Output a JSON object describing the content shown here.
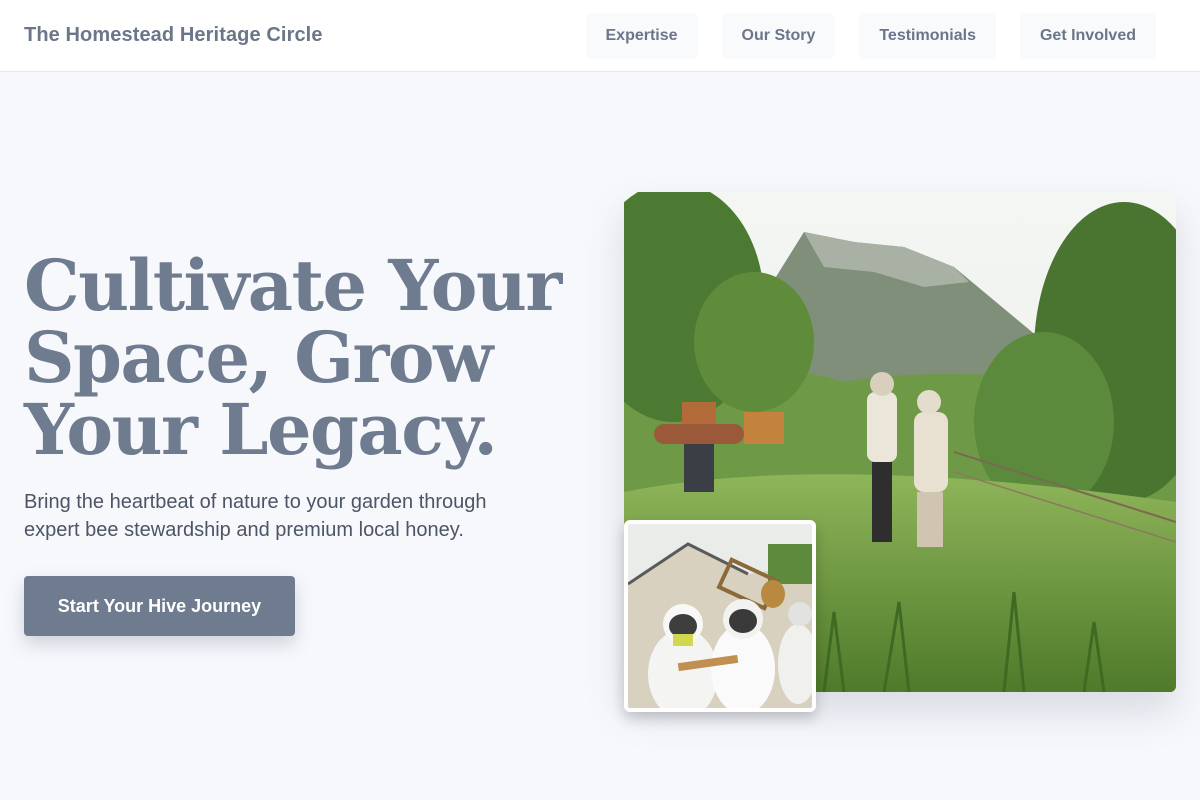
{
  "header": {
    "brand": "The Homestead Heritage Circle",
    "nav": [
      "Expertise",
      "Our Story",
      "Testimonials",
      "Get Involved"
    ]
  },
  "hero": {
    "title_lines": [
      "Cultivate Your",
      "Space, Grow",
      "Your Legacy."
    ],
    "subtitle": "Bring the heartbeat of nature to your garden through expert bee stewardship and premium local honey.",
    "cta_label": "Start Your Hive Journey"
  },
  "images": {
    "main": "beekeepers-in-mountain-meadow-photo",
    "inset": "beekeepers-holding-honeycomb-frame-photo"
  },
  "colors": {
    "background": "#f7f8fc",
    "accent": "#6f7b8f",
    "text": "#4b5565"
  }
}
